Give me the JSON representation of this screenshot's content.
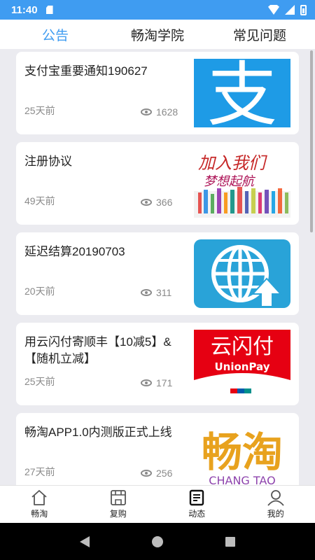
{
  "status": {
    "time": "11:40"
  },
  "tabs": [
    {
      "label": "公告",
      "active": true
    },
    {
      "label": "畅淘学院",
      "active": false
    },
    {
      "label": "常见问题",
      "active": false
    }
  ],
  "articles": [
    {
      "title": "支付宝重要通知190627",
      "date": "25天前",
      "views": "1628",
      "thumb": "alipay-logo"
    },
    {
      "title": "注册协议",
      "date": "49天前",
      "views": "366",
      "thumb": "dream-banner"
    },
    {
      "title": "延迟结算20190703",
      "date": "20天前",
      "views": "311",
      "thumb": "globe-upload"
    },
    {
      "title": "用云闪付寄顺丰【10减5】&【随机立减】",
      "date": "25天前",
      "views": "171",
      "thumb": "unionpay-logo"
    },
    {
      "title": "畅淘APP1.0内测版正式上线",
      "date": "27天前",
      "views": "256",
      "thumb": "changtao-logo"
    }
  ],
  "thumbs": {
    "alipay_char": "支",
    "dream_text_a": "加入我们",
    "dream_text_b": "梦想起航",
    "unionpay_cn": "云闪付",
    "unionpay_en": "UnionPay",
    "changtao_cn": "畅淘",
    "changtao_en": "CHANG TAO"
  },
  "nav": [
    {
      "label": "畅淘",
      "icon": "home-icon"
    },
    {
      "label": "复购",
      "icon": "shop-icon"
    },
    {
      "label": "动态",
      "icon": "news-icon"
    },
    {
      "label": "我的",
      "icon": "user-icon"
    }
  ],
  "colors": {
    "accent": "#3f9cf1",
    "alipay": "#1e9be6",
    "unionpay_red": "#e60012"
  }
}
